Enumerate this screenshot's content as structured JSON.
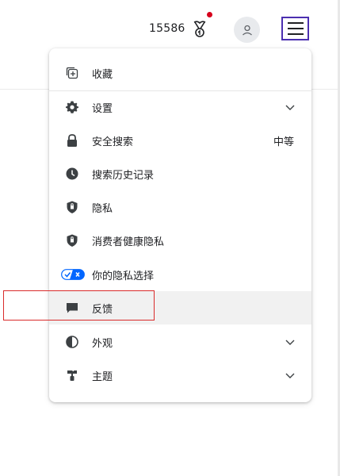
{
  "header": {
    "points": "15586",
    "notification_dot_color": "#d6001c",
    "menu_outline_color": "#4b2fb0"
  },
  "menu": {
    "items": [
      {
        "id": "collections",
        "label": "收藏",
        "icon": "collections-icon"
      },
      {
        "id": "settings",
        "label": "设置",
        "icon": "gear-icon",
        "expandable": true
      },
      {
        "id": "safesearch",
        "label": "安全搜索",
        "icon": "lock-icon",
        "value": "中等"
      },
      {
        "id": "history",
        "label": "搜索历史记录",
        "icon": "clock-icon"
      },
      {
        "id": "privacy",
        "label": "隐私",
        "icon": "shield-icon"
      },
      {
        "id": "consumer_health",
        "label": "消费者健康隐私",
        "icon": "shield-icon"
      },
      {
        "id": "privacy_choices",
        "label": "你的隐私选择",
        "icon": "privacy-toggle-icon"
      },
      {
        "id": "feedback",
        "label": "反馈",
        "icon": "feedback-icon",
        "highlighted": true
      },
      {
        "id": "appearance",
        "label": "外观",
        "icon": "contrast-icon",
        "expandable": true
      },
      {
        "id": "theme",
        "label": "主题",
        "icon": "paint-brush-icon",
        "expandable": true
      }
    ]
  },
  "annotation": {
    "box_color": "#d92b2b"
  }
}
